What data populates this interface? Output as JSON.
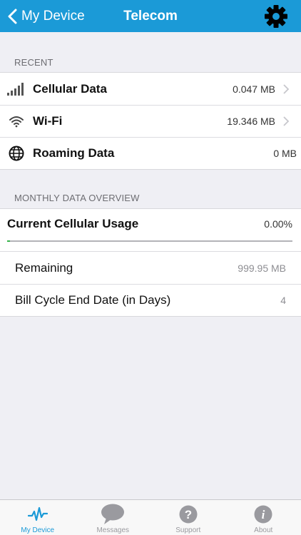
{
  "navbar": {
    "back_label": "My Device",
    "title": "Telecom",
    "settings_icon": "gear-icon"
  },
  "recent": {
    "header": "RECENT",
    "rows": [
      {
        "icon": "signal-bars-icon",
        "label": "Cellular Data",
        "value": "0.047 MB",
        "has_chevron": true
      },
      {
        "icon": "wifi-icon",
        "label": "Wi-Fi",
        "value": "19.346 MB",
        "has_chevron": true
      },
      {
        "icon": "globe-icon",
        "label": "Roaming Data",
        "value": "0 MB",
        "has_chevron": false
      }
    ]
  },
  "monthly": {
    "header": "MONTHLY DATA OVERVIEW",
    "usage_label": "Current Cellular Usage",
    "usage_value": "0.00%",
    "usage_fraction": 0.01,
    "rows": [
      {
        "label": "Remaining",
        "value": "999.95 MB"
      },
      {
        "label": "Bill Cycle End Date (in Days)",
        "value": "4"
      }
    ]
  },
  "tabbar": {
    "tabs": [
      {
        "icon": "pulse-icon",
        "label": "My Device",
        "active": true
      },
      {
        "icon": "speech-bubble-icon",
        "label": "Messages",
        "active": false
      },
      {
        "icon": "question-circle-icon",
        "label": "Support",
        "active": false
      },
      {
        "icon": "info-circle-icon",
        "label": "About",
        "active": false
      }
    ]
  },
  "colors": {
    "accent": "#1b9ad7",
    "progress": "#35b34a",
    "background": "#efeff4"
  }
}
